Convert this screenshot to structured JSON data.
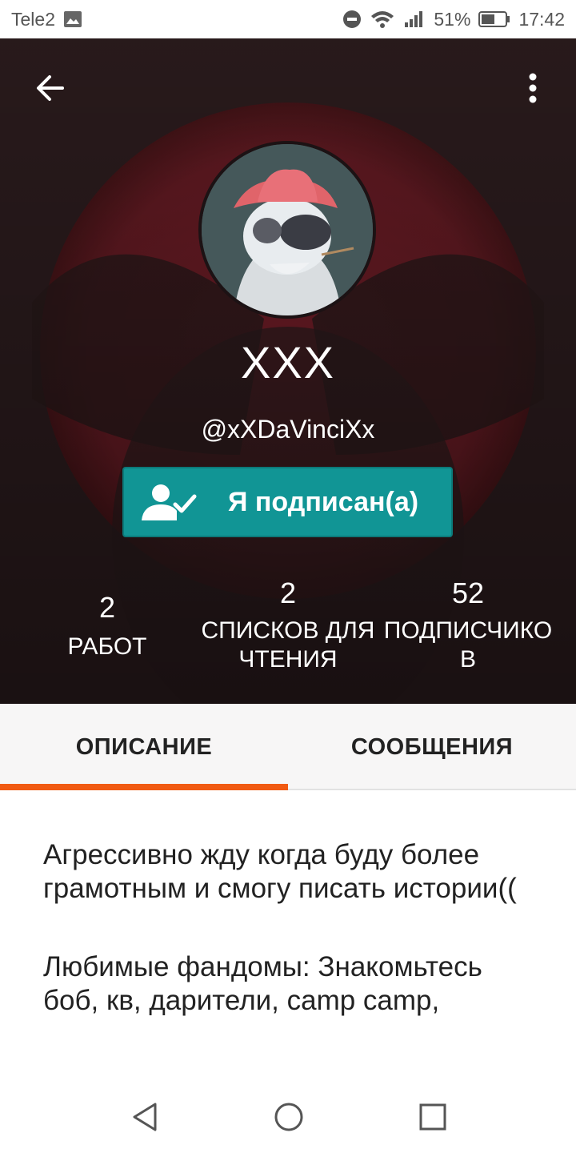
{
  "status_bar": {
    "carrier": "Tele2",
    "battery": "51%",
    "time": "17:42"
  },
  "profile": {
    "name": "XXX",
    "handle": "@xXDaVinciXx",
    "follow_button_label": "Я подписан(а)"
  },
  "stats": [
    {
      "value": "2",
      "label_line1": "РАБОТ",
      "label_line2": ""
    },
    {
      "value": "2",
      "label_line1": "СПИСКОВ ДЛЯ",
      "label_line2": "ЧТЕНИЯ"
    },
    {
      "value": "52",
      "label_line1": "ПОДПИСЧИКО",
      "label_line2": "В"
    }
  ],
  "tabs": [
    {
      "label": "ОПИСАНИЕ",
      "active": true
    },
    {
      "label": "СООБЩЕНИЯ",
      "active": false
    }
  ],
  "description": [
    "Агрессивно жду когда буду более грамотным и смогу писать истории((",
    "Любимые фандомы: Знакомьтесь боб, кв, дарители, camp camp,"
  ],
  "colors": {
    "accent_tab": "#f15a12",
    "follow_button": "#119595",
    "hero_red": "#7a1f2a"
  },
  "icons": {
    "back": "arrow-left-icon",
    "more": "more-vertical-icon",
    "follow": "user-check-icon"
  }
}
